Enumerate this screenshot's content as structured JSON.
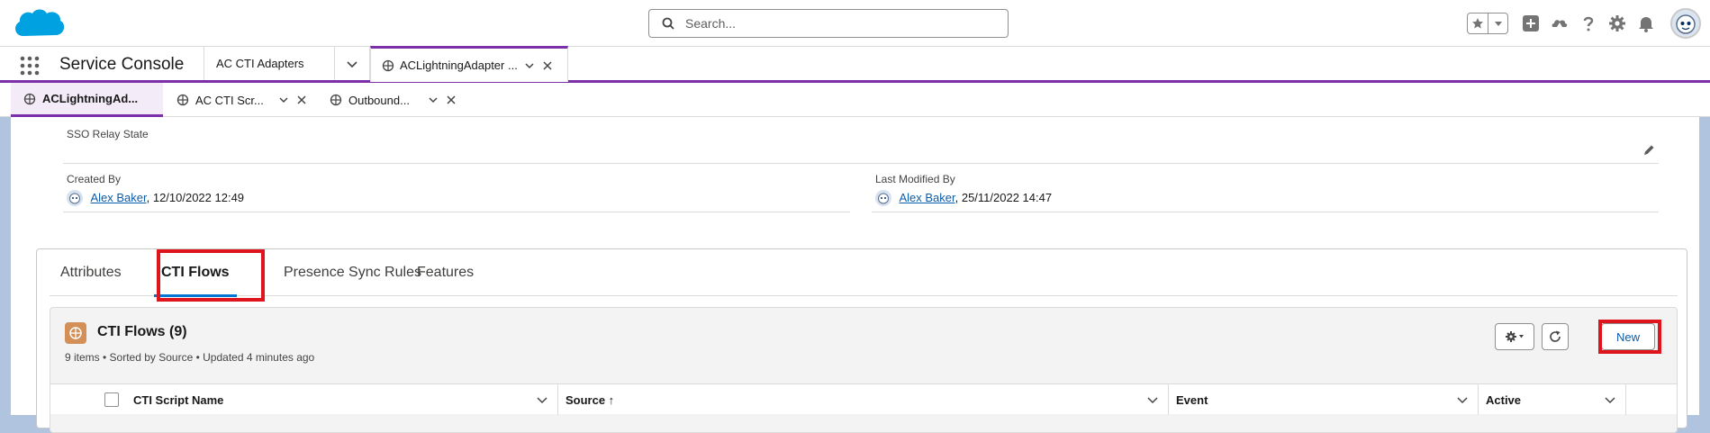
{
  "search": {
    "placeholder": "Search..."
  },
  "nav": {
    "app_name": "Service Console",
    "tabs": [
      {
        "label": "AC CTI Adapters"
      },
      {
        "label": "ACLightningAdapter ..."
      }
    ]
  },
  "subtabs": [
    {
      "label": "ACLightningAd..."
    },
    {
      "label": "AC CTI Scr..."
    },
    {
      "label": "Outbound..."
    }
  ],
  "record": {
    "sso_label": "SSO Relay State",
    "created_by_label": "Created By",
    "created_by_name": "Alex Baker",
    "created_by_date": ", 12/10/2022 12:49",
    "modified_by_label": "Last Modified By",
    "modified_by_name": "Alex Baker",
    "modified_by_date": ", 25/11/2022 14:47"
  },
  "related_tabs": [
    {
      "label": "Attributes"
    },
    {
      "label": "CTI Flows"
    },
    {
      "label": "Presence Sync Rules"
    },
    {
      "label": "Features"
    }
  ],
  "related_card": {
    "title": "CTI Flows (9)",
    "meta": "9 items • Sorted by Source • Updated 4 minutes ago",
    "new_label": "New",
    "columns": [
      {
        "label": "CTI Script Name"
      },
      {
        "label": "Source ↑"
      },
      {
        "label": "Event"
      },
      {
        "label": "Active"
      }
    ]
  },
  "colors": {
    "brand_blue": "#0176d3",
    "console_purple": "#7b2fa8",
    "highlight_red": "#e0141c",
    "cti_icon_orange": "#d38f58"
  }
}
